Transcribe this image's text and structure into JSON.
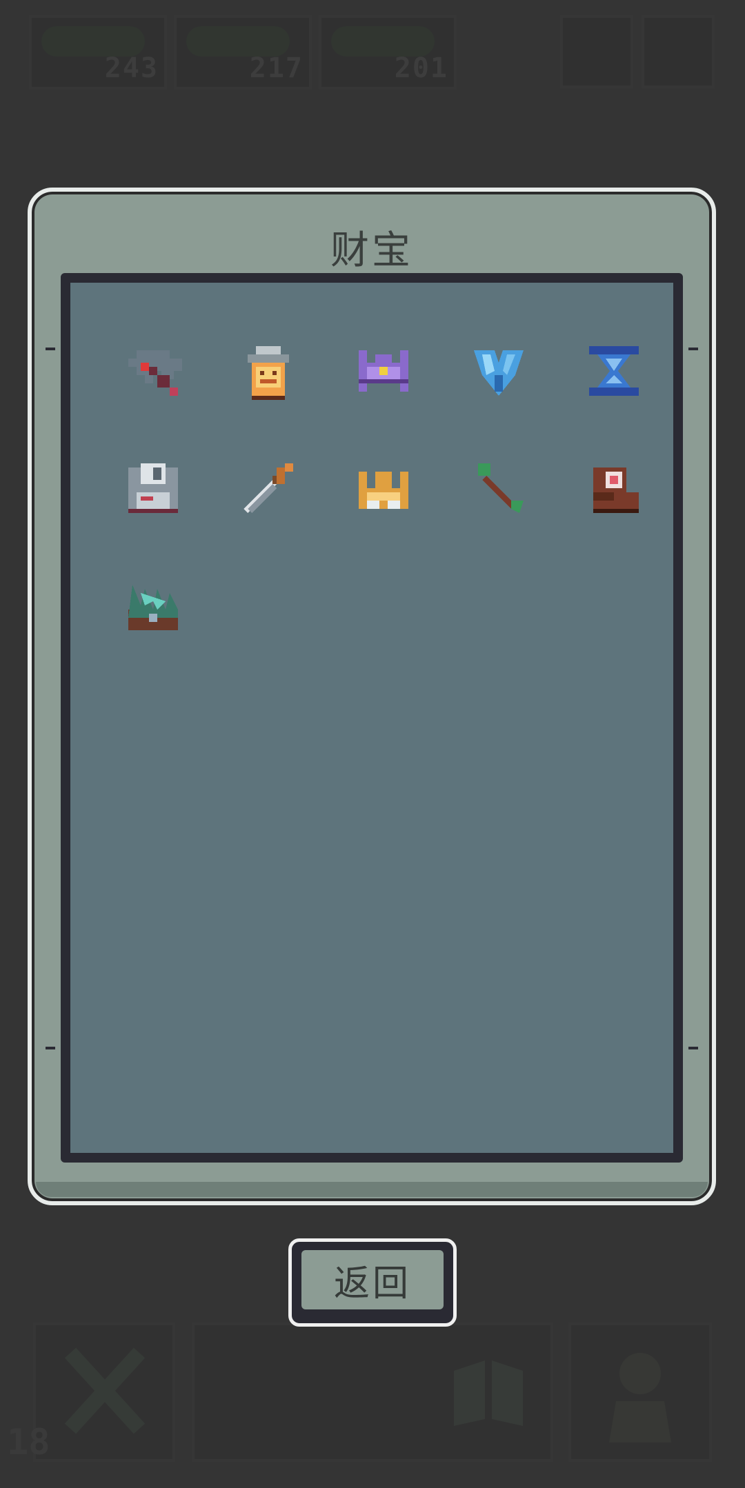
{
  "hud": {
    "resources": [
      {
        "icon": "gem-pile-icon",
        "value": "243"
      },
      {
        "icon": "gem-pile-icon",
        "value": "217"
      },
      {
        "icon": "gem-pile-icon",
        "value": "201"
      }
    ],
    "floor": "18"
  },
  "panel": {
    "title": "财宝",
    "items": [
      {
        "icon": "pickaxe-icon"
      },
      {
        "icon": "lantern-icon"
      },
      {
        "icon": "purple-crown-icon"
      },
      {
        "icon": "blue-crystal-icon"
      },
      {
        "icon": "hourglass-icon"
      },
      {
        "icon": "floppy-disk-icon"
      },
      {
        "icon": "sword-icon"
      },
      {
        "icon": "gold-crown-icon"
      },
      {
        "icon": "arrow-icon"
      },
      {
        "icon": "boot-icon"
      },
      {
        "icon": "green-grass-block-icon"
      }
    ]
  },
  "back_button": {
    "label": "返回"
  },
  "colors": {
    "background": "#343434",
    "panel": "#8c9c94",
    "panel_inner": "#5e747c",
    "border_light": "#e8ecea",
    "border_dark": "#2a2a33"
  }
}
